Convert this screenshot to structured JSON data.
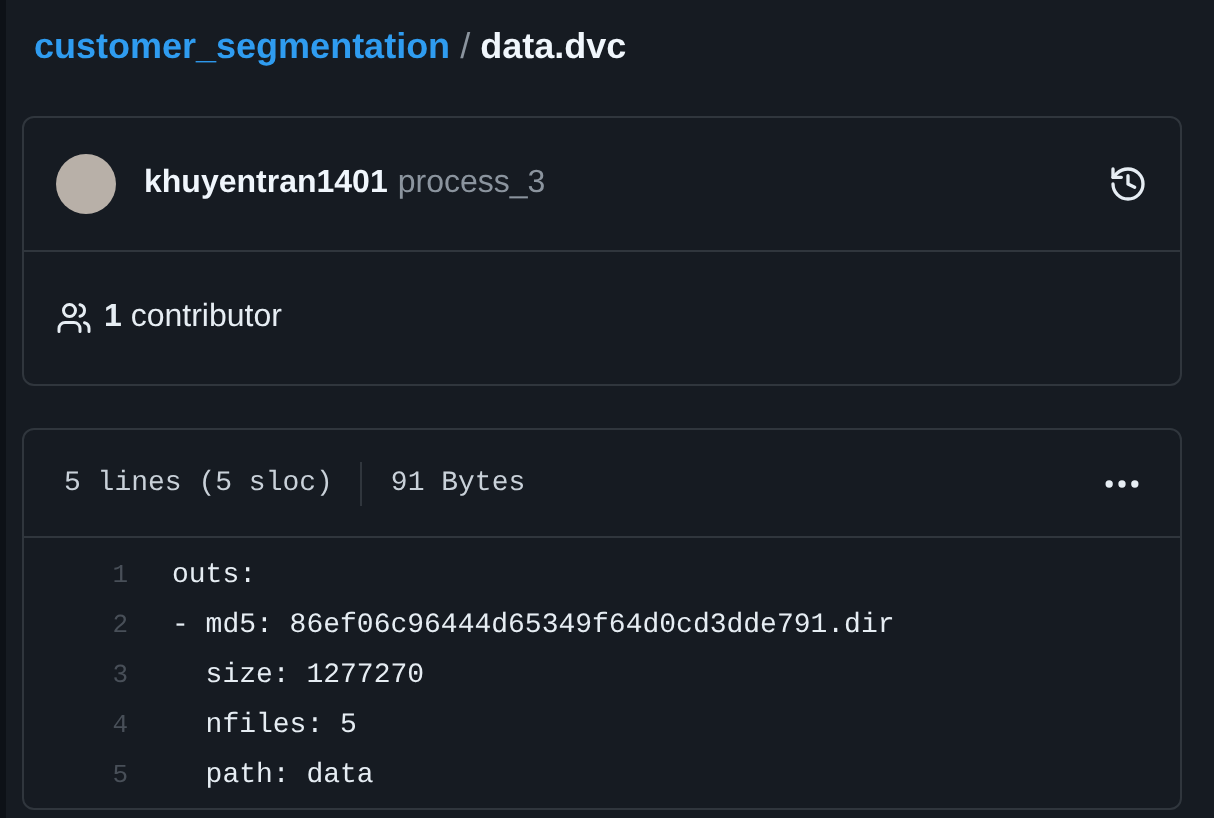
{
  "breadcrumb": {
    "repo": "customer_segmentation",
    "separator": "/",
    "file": "data.dvc"
  },
  "commit": {
    "author": "khuyentran1401",
    "message": "process_3"
  },
  "contributors": {
    "text": "**1** contributor"
  },
  "file_info": {
    "lines": "5 lines (5 sloc)",
    "size": "91 Bytes"
  },
  "code_lines": [
    {
      "number": "1",
      "text": "outs:"
    },
    {
      "number": "2",
      "text": "- md5: 86ef06c96444d65349f64d0cd3dde791.dir"
    },
    {
      "number": "3",
      "text": "  size: 1277270"
    },
    {
      "number": "4",
      "text": "  nfiles: 5"
    },
    {
      "number": "5",
      "text": "  path: data"
    }
  ]
}
